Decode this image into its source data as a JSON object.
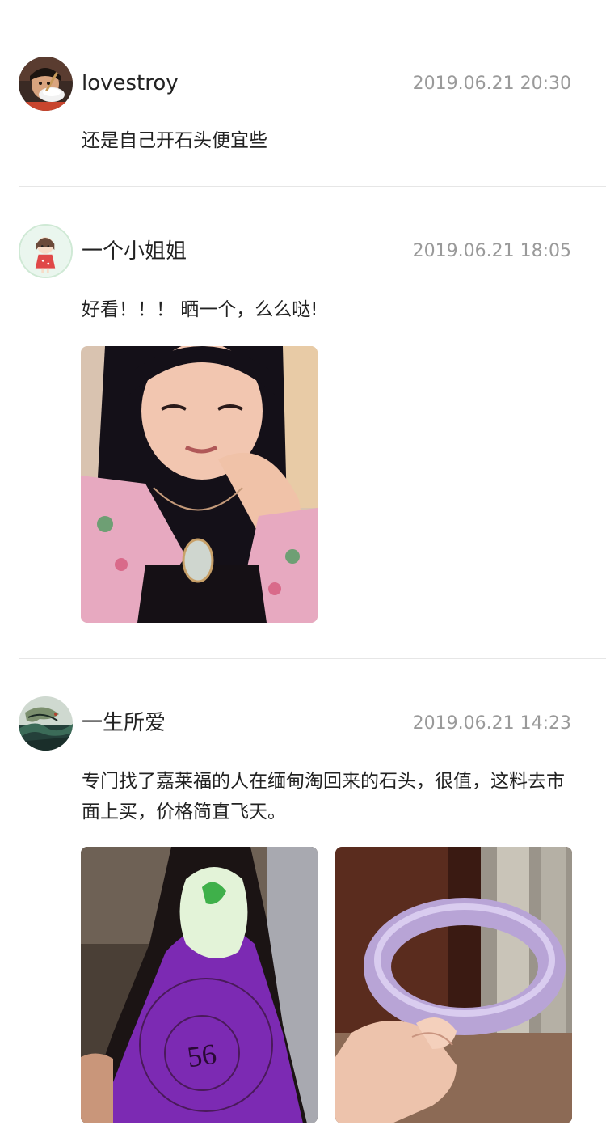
{
  "comments": [
    {
      "username": "lovestroy",
      "timestamp": "2019.06.21 20:30",
      "text": "还是自己开石头便宜些",
      "avatar_icon": "eating-child-avatar-icon",
      "photos": []
    },
    {
      "username": "一个小姐姐",
      "timestamp": "2019.06.21 18:05",
      "text": "好看！！！ 晒一个，么么哒!",
      "avatar_icon": "cartoon-girl-avatar-icon",
      "photos": [
        "selfie-with-jade-pendant"
      ]
    },
    {
      "username": "一生所爱",
      "timestamp": "2019.06.21 14:23",
      "text": "专门找了嘉莱福的人在缅甸淘回来的石头，很值，这料去市面上买，价格简直飞天。",
      "avatar_icon": "dragon-painting-avatar-icon",
      "photos": [
        "purple-jade-rough-stone",
        "lavender-jade-bangle"
      ],
      "stone_marking": "56"
    }
  ],
  "colors": {
    "text": "#222222",
    "timestamp": "#9a9a9a",
    "divider": "#e6e6e6"
  }
}
